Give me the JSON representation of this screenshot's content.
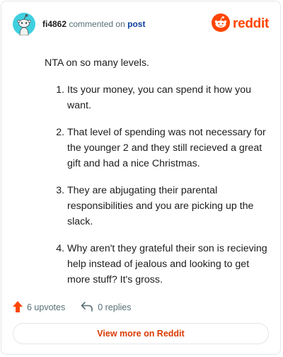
{
  "header": {
    "username": "fi4862",
    "commented_on": "commented on",
    "post_link": "post",
    "brand": "reddit"
  },
  "comment": {
    "intro": "NTA on so many levels.",
    "points": [
      "Its your money, you can spend it how you want.",
      "That level of spending was not necessary for the younger 2 and they still recieved a great gift and had a nice Christmas.",
      "They are abjugating their parental responsibilities and you are picking up the slack.",
      "Why aren't they grateful their son is recieving help instead of jealous and looking to get more stuff? It's gross."
    ]
  },
  "actions": {
    "upvotes": "6 upvotes",
    "replies": "0 replies"
  },
  "footer": {
    "view_more": "View more on Reddit"
  },
  "colors": {
    "brand": "#ff4500",
    "avatar_bg": "#3fd0df",
    "link": "#0a3f9e"
  },
  "icons": {
    "avatar": "snoo-avatar-icon",
    "logo": "reddit-logo-icon",
    "upvote": "upvote-arrow-icon",
    "reply": "reply-arrow-icon"
  }
}
